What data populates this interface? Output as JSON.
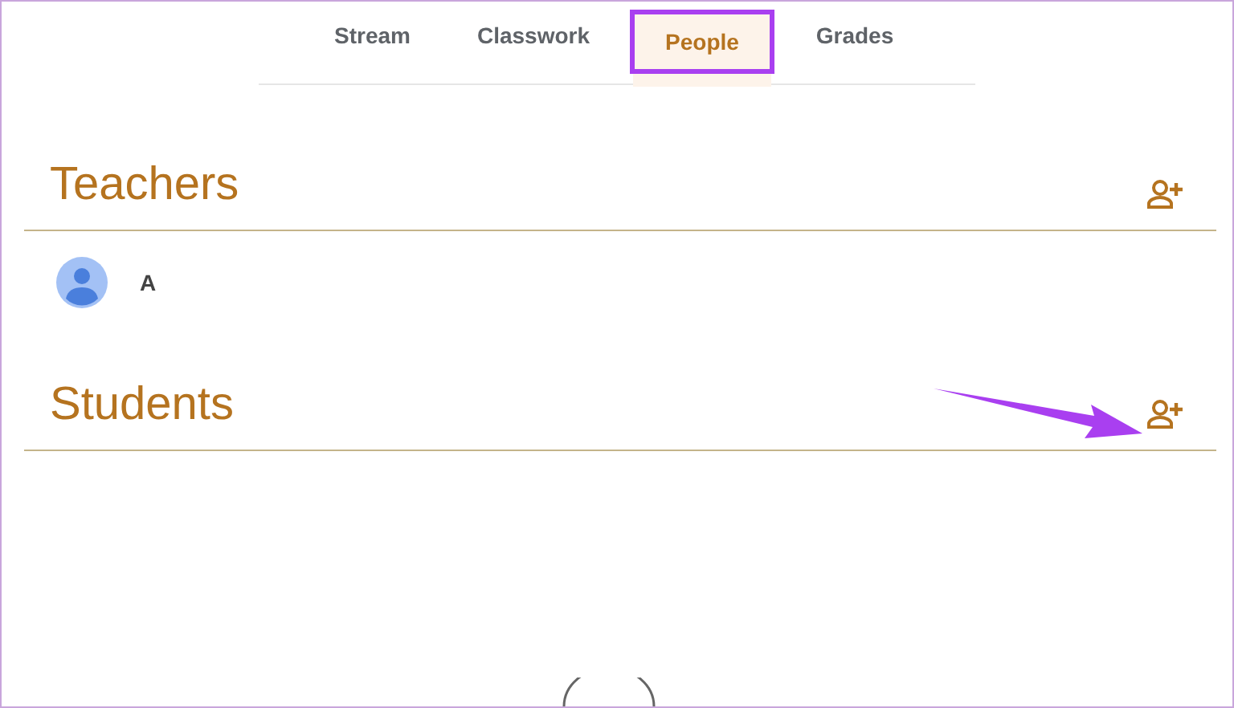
{
  "tabs": [
    {
      "label": "Stream",
      "selected": false,
      "highlighted": false
    },
    {
      "label": "Classwork",
      "selected": false,
      "highlighted": false
    },
    {
      "label": "People",
      "selected": true,
      "highlighted": true
    },
    {
      "label": "Grades",
      "selected": false,
      "highlighted": false
    }
  ],
  "sections": [
    {
      "title": "Teachers",
      "pointed": false,
      "people": [
        {
          "name": "A"
        }
      ]
    },
    {
      "title": "Students",
      "pointed": true
    }
  ]
}
